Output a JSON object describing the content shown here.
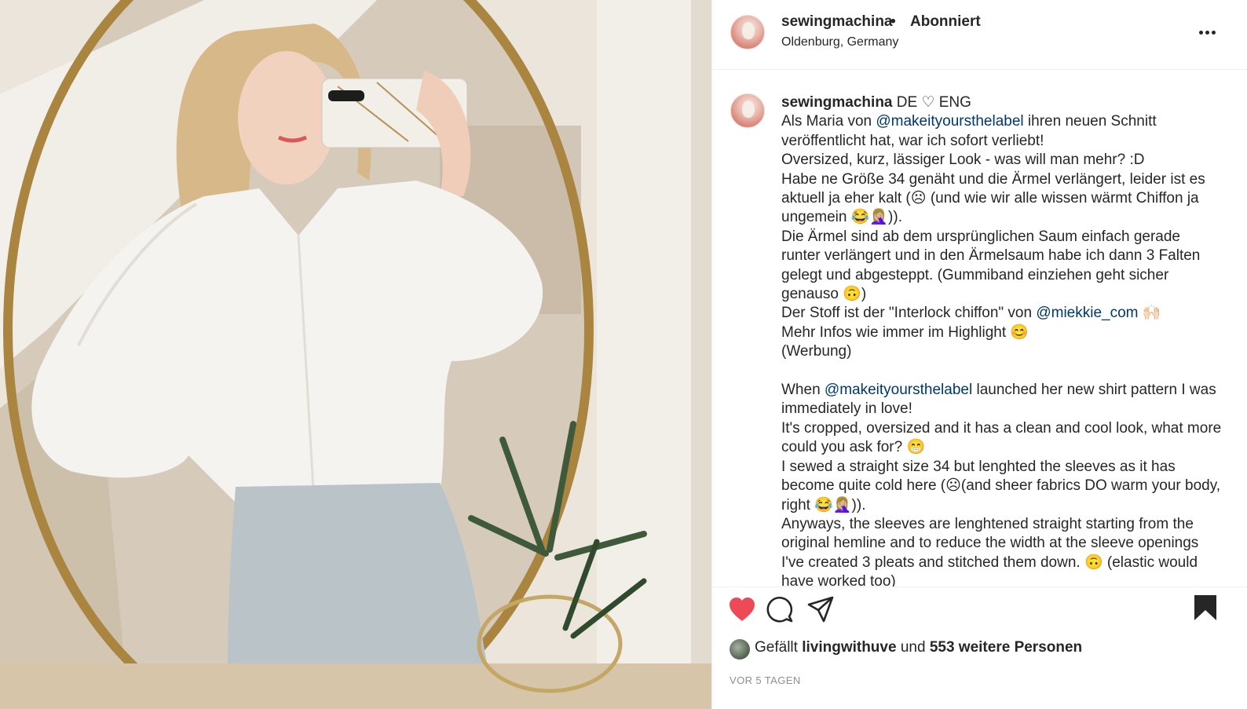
{
  "post_image": {
    "alt_icon": "photo",
    "colors": {
      "wall": "#ece6dc",
      "mirror_frame": "#b08a47",
      "blouse": "#f4f2ee",
      "jeans": "#b7c1c6",
      "hair": "#d9b98a"
    }
  },
  "header": {
    "username": "sewingmachina",
    "separator": "•",
    "follow_status": "Abonniert",
    "location": "Oldenburg, Germany",
    "more_icon": "more-horizontal-icon"
  },
  "caption": {
    "username": "sewingmachina",
    "lines": {
      "l01": " DE ♡ ENG",
      "l02a": "Als Maria von ",
      "l02m": "@makeityoursthelabel",
      "l02b": " ihren neuen Schnitt veröffentlicht hat, war ich sofort verliebt!",
      "l03": "Oversized, kurz, lässiger Look - was will man mehr? :D",
      "l04": "Habe ne Größe 34 genäht und die Ärmel verlängert, leider ist es aktuell ja eher kalt (☹ (und wie wir alle wissen wärmt Chiffon ja ungemein 😂🤦🏼‍♀️)).",
      "l05": "Die Ärmel sind ab dem ursprünglichen Saum einfach gerade runter verlängert und in den Ärmelsaum habe ich dann 3 Falten gelegt und abgesteppt. (Gummiband einziehen geht sicher genauso 🙃)",
      "l06a": "Der Stoff ist der \"Interlock chiffon\" von ",
      "l06m": "@miekkie_com",
      "l06b": " 🙌🏻",
      "l07": "Mehr Infos wie immer im Highlight 😊",
      "l08": "(Werbung)",
      "l09a": "When ",
      "l09m": "@makeityoursthelabel",
      "l09b": " launched her new shirt pattern I was immediately in love!",
      "l10": "It's cropped, oversized and it has a clean and cool look, what more could you ask for? 😁",
      "l11": "I sewed a straight size 34 but lenghted the sleeves as it has become quite cold here (☹(and sheer fabrics DO warm your body, right 😂🤦🏼‍♀️)).",
      "l12": "Anyways, the sleeves are lenghtened straight starting from the original hemline and to reduce the width at the sleeve openings I've created 3 pleats and stitched them down. 🙃 (elastic would have worked too)"
    }
  },
  "actions": {
    "like_icon": "heart-filled-icon",
    "comment_icon": "comment-icon",
    "share_icon": "share-paper-plane-icon",
    "save_icon": "bookmark-filled-icon",
    "like_color": "#ed4956"
  },
  "likes": {
    "prefix": "Gefällt ",
    "user": "livingwithuve",
    "middle": " und ",
    "count_text": "553 weitere Personen"
  },
  "timestamp": "VOR 5 TAGEN"
}
